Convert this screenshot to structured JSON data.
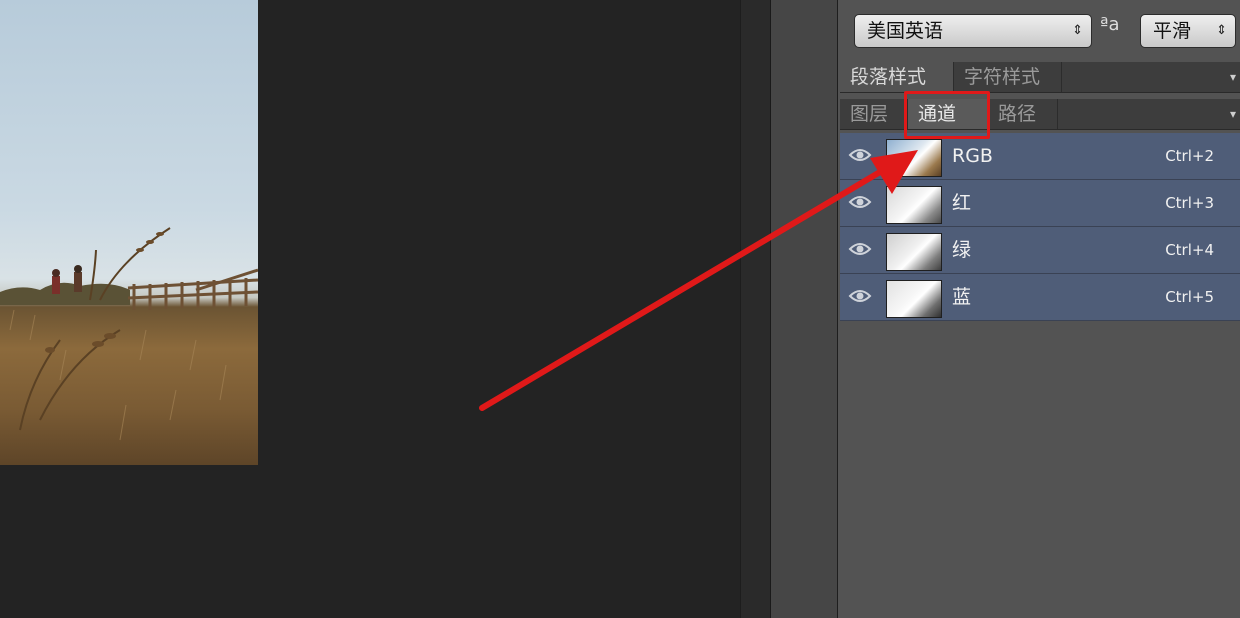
{
  "top_controls": {
    "language_value": "美国英语",
    "aa_glyph": "ªa",
    "antialias_value": "平滑"
  },
  "tab_row_1": [
    "段落样式",
    "字符样式"
  ],
  "tab_row_2": [
    "图层",
    "通道",
    "路径"
  ],
  "channels": [
    {
      "name": "RGB",
      "shortcut": "Ctrl+2"
    },
    {
      "name": "红",
      "shortcut": "Ctrl+3"
    },
    {
      "name": "绿",
      "shortcut": "Ctrl+4"
    },
    {
      "name": "蓝",
      "shortcut": "Ctrl+5"
    }
  ],
  "colors": {
    "highlight": "#e01919",
    "selected_row": "#4f5d78",
    "panel": "#535353"
  }
}
